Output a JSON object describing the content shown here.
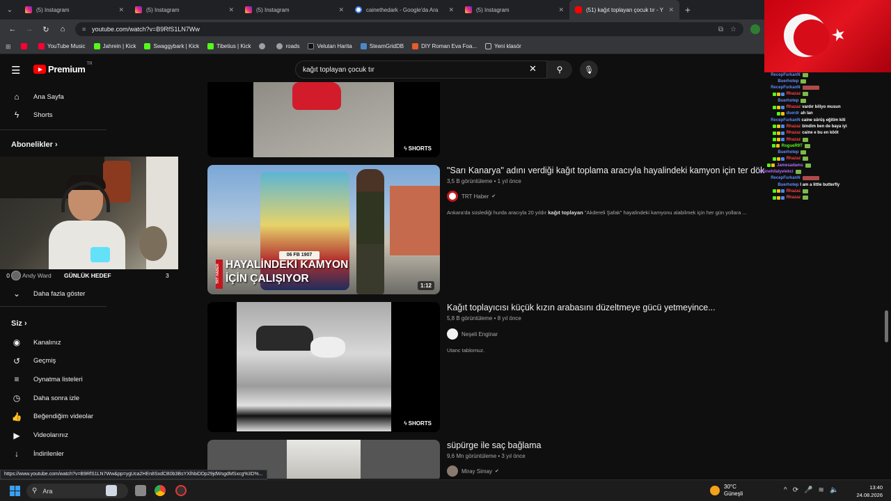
{
  "browser": {
    "tabs": [
      {
        "title": "(5) Instagram",
        "type": "instagram"
      },
      {
        "title": "(5) Instagram",
        "type": "instagram"
      },
      {
        "title": "(5) Instagram",
        "type": "instagram"
      },
      {
        "title": "cainethedark - Google'da Ara",
        "type": "google"
      },
      {
        "title": "(5) Instagram",
        "type": "instagram"
      },
      {
        "title": "(51) kağıt toplayan çocuk tır - Y",
        "type": "youtube",
        "active": true
      }
    ],
    "url": "youtube.com/watch?v=B9RfS1LN7Ww",
    "bookmarks": [
      {
        "label": "",
        "icon": "youtube"
      },
      {
        "label": "YouTube Music",
        "icon": "youtube"
      },
      {
        "label": "Jahrein | Kick",
        "icon": "kick"
      },
      {
        "label": "Swaggybark | Kick",
        "icon": "kick"
      },
      {
        "label": "Tibetius | Kick",
        "icon": "kick"
      },
      {
        "label": "",
        "icon": "globe"
      },
      {
        "label": "roads",
        "icon": "globe"
      },
      {
        "label": "Velutan Harita",
        "icon": "velutan"
      },
      {
        "label": "SteamGridDB",
        "icon": "steam"
      },
      {
        "label": "DIY Roman Eva Foa...",
        "icon": "rr"
      },
      {
        "label": "Yeni klasör",
        "icon": "folder"
      }
    ],
    "status_url": "https://www.youtube.com/watch?v=B9RfS1LN7Ww&pp=ygUca2HEn8SxdCB0b3BsYXlhbiDDp29jdWsgdMSxcg%3D%..."
  },
  "youtube": {
    "logo_text": "Premium",
    "logo_region": "TR",
    "search_query": "kağıt toplayan çocuk tır",
    "sidebar": {
      "top": [
        {
          "label": "Ana Sayfa",
          "icon": "home-icon"
        },
        {
          "label": "Shorts",
          "icon": "shorts-icon"
        }
      ],
      "subscriptions_heading": "Abonelikler",
      "subscription_partial": "Andy Ward",
      "show_more": "Daha fazla göster",
      "you_heading": "Siz",
      "you_items": [
        {
          "label": "Kanalınız",
          "icon": "channel-icon"
        },
        {
          "label": "Geçmiş",
          "icon": "history-icon"
        },
        {
          "label": "Oynatma listeleri",
          "icon": "playlists-icon"
        },
        {
          "label": "Daha sonra izle",
          "icon": "watch-later-icon"
        },
        {
          "label": "Beğendiğim videolar",
          "icon": "liked-icon"
        },
        {
          "label": "Videolarınız",
          "icon": "your-videos-icon"
        },
        {
          "label": "İndirilenler",
          "icon": "downloads-icon"
        }
      ]
    },
    "results": [
      {
        "badge": "SHORTS"
      },
      {
        "title": "\"Sarı Kanarya\" adını verdiği kağıt toplama aracıyla hayalindeki kamyon için ter döküyor",
        "views": "3,5 B görüntüleme",
        "age": "1 yıl önce",
        "channel": "TRT Haber",
        "verified": true,
        "desc_before": "Ankara'da süslediği hurda aracıyla 20 yıldır ",
        "desc_bold": "kağıt toplayan",
        "desc_after": " \"Akdereli Şafak\" hayalindeki kamyonu alabilmek için her gün yollara ...",
        "thumb_caption_1": "HAYALİNDEKİ KAMYON",
        "thumb_caption_2": "İÇİN ÇALIŞIYOR",
        "thumb_tag": "TRT HABER",
        "thumb_plate": "06 FB 1907",
        "duration": "1:12"
      },
      {
        "title": "Kağıt toplayıcısı küçük kızın arabasını düzeltmeye gücü yetmeyince...",
        "views": "5,8 B görüntüleme",
        "age": "8 yıl önce",
        "channel": "Neşeli Enginar",
        "desc": "Utanc tablomuz.",
        "badge": "SHORTS"
      },
      {
        "title": "süpürge ile saç bağlama",
        "views": "9,6 Mn görüntüleme",
        "age": "3 yıl önce",
        "channel": "Miray Simay",
        "verified": true
      }
    ]
  },
  "stream_overlay": {
    "goal_zero": "0",
    "goal_label": "GÜNLÜK HEDEF",
    "goal_count": "3",
    "chat": [
      {
        "name": "RecepFurkanN",
        "color": "#5b8cff",
        "msg": "",
        "emote": "small"
      },
      {
        "name": "Buerhotep",
        "color": "#6c8cff",
        "msg": "",
        "emote": "small"
      },
      {
        "name": "RecepFurkanN",
        "color": "#5b8cff",
        "msg": "",
        "emote": "big"
      },
      {
        "name": "Rhazaz",
        "color": "#ff4040",
        "msg": "",
        "emote": "small",
        "badges": 3
      },
      {
        "name": "Buerhotep",
        "color": "#6c8cff",
        "msg": "",
        "emote": "small"
      },
      {
        "name": "Rhazaz",
        "color": "#ff4040",
        "msg": "vardır biliyo musun",
        "badges": 3
      },
      {
        "name": "dserdr",
        "color": "#5b8cff",
        "msg": "ah lan",
        "badges": 2
      },
      {
        "name": "RecepFurkanN",
        "color": "#5b8cff",
        "msg": "caine sürüş eğitim kiti"
      },
      {
        "name": "Rhazaz",
        "color": "#ff4040",
        "msg": "bindim ben de baya iyi",
        "badges": 3
      },
      {
        "name": "Rhazaz",
        "color": "#ff4040",
        "msg": "caine e bu en kööt",
        "badges": 3
      },
      {
        "name": "Rhazaz",
        "color": "#ff4040",
        "msg": "",
        "emote": "small",
        "badges": 3
      },
      {
        "name": "RogueR9T",
        "color": "#53fc18",
        "msg": "",
        "emote": "small",
        "badges": 2
      },
      {
        "name": "Buerhotep",
        "color": "#6c8cff",
        "msg": "",
        "emote": "small"
      },
      {
        "name": "Rhazaz",
        "color": "#ff4040",
        "msg": "",
        "emote": "small",
        "badges": 3
      },
      {
        "name": "Jamesadams",
        "color": "#b06cff",
        "msg": "",
        "emote": "small",
        "badges": 2
      },
      {
        "name": "eminehilalyelekci",
        "color": "#b06cff",
        "msg": "",
        "emote": "small"
      },
      {
        "name": "RecepFurkanN",
        "color": "#5b8cff",
        "msg": "",
        "emote": "big"
      },
      {
        "name": "Buerhotep",
        "color": "#6c8cff",
        "msg": "I am a little butterfly"
      },
      {
        "name": "Rhazaz",
        "color": "#ff4040",
        "msg": "",
        "emote": "small",
        "badges": 3
      },
      {
        "name": "Rhazaz",
        "color": "#ff4040",
        "msg": "",
        "emote": "small",
        "badges": 3
      }
    ]
  },
  "taskbar": {
    "search_label": "Ara",
    "temperature": "30°C",
    "weather": "Güneşli",
    "time": "13:40",
    "date": "24.08.2026"
  }
}
